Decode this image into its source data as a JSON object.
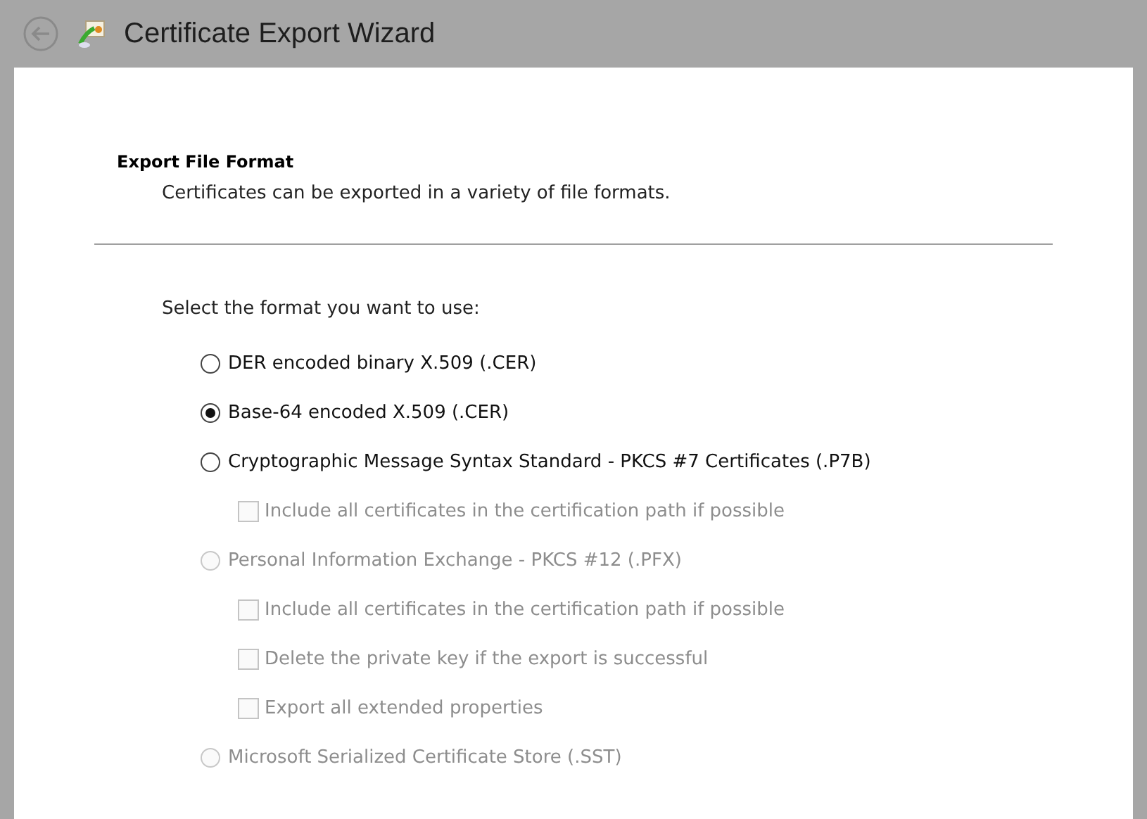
{
  "window": {
    "title": "Certificate Export Wizard"
  },
  "header": {
    "title": "Export File Format",
    "subtitle": "Certificates can be exported in a variety of file formats."
  },
  "prompt": "Select the format you want to use:",
  "formats": [
    {
      "label": "DER encoded binary X.509 (.CER)",
      "selected": false,
      "disabled": false
    },
    {
      "label": "Base-64 encoded X.509 (.CER)",
      "selected": true,
      "disabled": false
    },
    {
      "label": "Cryptographic Message Syntax Standard - PKCS #7 Certificates (.P7B)",
      "selected": false,
      "disabled": false,
      "options": [
        {
          "label": "Include all certificates in the certification path if possible",
          "checked": false,
          "disabled": true
        }
      ]
    },
    {
      "label": "Personal Information Exchange - PKCS #12 (.PFX)",
      "selected": false,
      "disabled": true,
      "options": [
        {
          "label": "Include all certificates in the certification path if possible",
          "checked": false,
          "disabled": true
        },
        {
          "label": "Delete the private key if the export is successful",
          "checked": false,
          "disabled": true
        },
        {
          "label": "Export all extended properties",
          "checked": false,
          "disabled": true
        }
      ]
    },
    {
      "label": "Microsoft Serialized Certificate Store (.SST)",
      "selected": false,
      "disabled": true
    }
  ]
}
